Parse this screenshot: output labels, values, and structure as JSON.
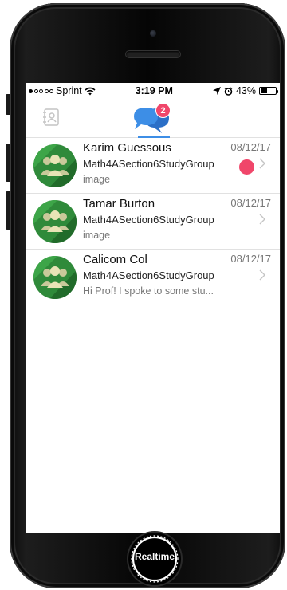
{
  "status_bar": {
    "carrier": "Sprint",
    "time": "3:19 PM",
    "battery_percent": "43%",
    "battery_level": 0.43,
    "signal_bars_filled": 1,
    "signal_bars_total": 5
  },
  "tabs": {
    "contacts_icon": "contacts-icon",
    "chats_icon": "chat-bubbles-icon",
    "chats_badge": "2",
    "active_tab": "chats",
    "accent_color": "#3d8ee6",
    "badge_color": "#f0466a"
  },
  "conversations": [
    {
      "name": "Karim Guessous",
      "group": "Math4ASection6StudyGroup",
      "preview": "image",
      "date": "08/12/17",
      "unread": true
    },
    {
      "name": "Tamar Burton",
      "group": "Math4ASection6StudyGroup",
      "preview": "image",
      "date": "08/12/17",
      "unread": false
    },
    {
      "name": "Calicom Col",
      "group": "Math4ASection6StudyGroup",
      "preview": "Hi Prof! I spoke to some stu...",
      "date": "08/12/17",
      "unread": false
    }
  ],
  "home_button": {
    "label": "Realtime"
  }
}
